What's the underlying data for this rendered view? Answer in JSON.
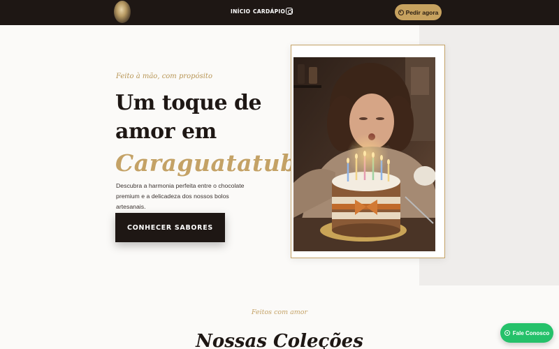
{
  "nav": {
    "items": [
      "INÍCIO",
      "CARDÁPIO"
    ],
    "order_button": "Pedir agora",
    "icons": [
      "logo",
      "instagram-icon",
      "whatsapp-icon"
    ]
  },
  "hero": {
    "kicker": "Feito à mão, com propósito",
    "title_line1": "Um toque de",
    "title_line2": "amor em",
    "title_script": "Caraguatatuba.",
    "description_line1": "Descubra a harmonia perfeita entre o chocolate",
    "description_line2": "premium e a delicadeza dos nossos bolos artesanais.",
    "cta": "CONHECER SABORES"
  },
  "collections": {
    "kicker": "Feitos com amor",
    "title": "Nossas Coleções"
  },
  "floating_button": {
    "label": "Fale Conosco",
    "icon": "whatsapp-icon"
  },
  "colors": {
    "dark": "#1e1714",
    "gold": "#c4a266",
    "whatsapp": "#25c16a"
  }
}
